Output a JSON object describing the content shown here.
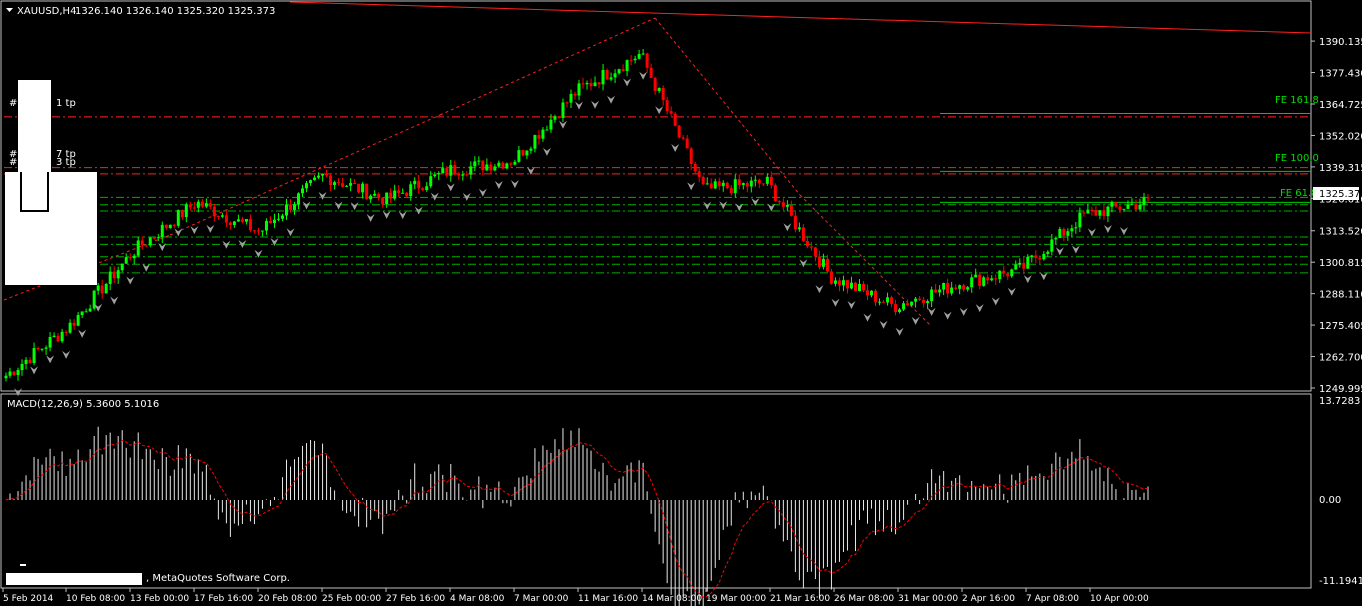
{
  "header": {
    "symbol_label": "XAUUSD,H4",
    "ohlc": "1326.140 1326.140 1325.320 1325.373"
  },
  "macd": {
    "label": "MACD(12,26,9) 5.3600 5.1016",
    "scale_labels": [
      "13.7283",
      "0.00",
      "-11.1941"
    ]
  },
  "copyright": ", MetaQuotes Software Corp.",
  "price_axis": {
    "ticks": [
      "1390.135",
      "1377.430",
      "1364.725",
      "1352.020",
      "1339.315",
      "1326.610",
      "1313.520",
      "1300.815",
      "1288.110",
      "1275.405",
      "1262.700",
      "1249.995"
    ],
    "current_price": "1325.373"
  },
  "time_axis": {
    "ticks": [
      "5 Feb 2014",
      "10 Feb 08:00",
      "13 Feb 00:00",
      "17 Feb 16:00",
      "20 Feb 08:00",
      "25 Feb 00:00",
      "27 Feb 16:00",
      "4 Mar 08:00",
      "7 Mar 00:00",
      "11 Mar 16:00",
      "14 Mar 08:00",
      "19 Mar 00:00",
      "21 Mar 16:00",
      "26 Mar 08:00",
      "31 Mar 00:00",
      "2 Apr 16:00",
      "7 Apr 08:00",
      "10 Apr 00:00"
    ]
  },
  "level_labels": {
    "fe_161": "FE 161.8",
    "fe_100": "FE 100.0",
    "fe_61": "FE 61.8",
    "tp1": "1 tp",
    "tp7": "7 tp",
    "tp3": "3 tp",
    "hash": "#"
  },
  "colors": {
    "background": "#000000",
    "bull": "#00ff00",
    "bear": "#ff0000",
    "fe_line": "#00cc00",
    "level_red": "#ff2020",
    "level_green": "#00b000",
    "trend_line": "#ff2020"
  },
  "chart_data": [
    {
      "type": "candlestick",
      "symbol": "XAUUSD",
      "timeframe": "H4",
      "ylim": [
        1249.995,
        1393
      ],
      "trend": [
        {
          "date": "5 Feb",
          "price": 1255
        },
        {
          "date": "10 Feb",
          "price": 1275
        },
        {
          "date": "13 Feb",
          "price": 1305
        },
        {
          "date": "17 Feb",
          "price": 1325
        },
        {
          "date": "20 Feb",
          "price": 1313
        },
        {
          "date": "25 Feb",
          "price": 1336
        },
        {
          "date": "27 Feb",
          "price": 1326
        },
        {
          "date": "4 Mar",
          "price": 1338
        },
        {
          "date": "7 Mar",
          "price": 1342
        },
        {
          "date": "11 Mar",
          "price": 1370
        },
        {
          "date": "14 Mar",
          "price": 1385
        },
        {
          "date": "19 Mar",
          "price": 1330
        },
        {
          "date": "21 Mar",
          "price": 1333
        },
        {
          "date": "26 Mar",
          "price": 1295
        },
        {
          "date": "31 Mar",
          "price": 1283
        },
        {
          "date": "2 Apr",
          "price": 1292
        },
        {
          "date": "7 Apr",
          "price": 1298
        },
        {
          "date": "10 Apr",
          "price": 1320
        },
        {
          "date": "11 Apr",
          "price": 1325.373
        }
      ],
      "levels": {
        "fe_161_8": 1360.5,
        "fe_100": 1337.5,
        "fe_61_8": 1325.0,
        "tp1": 1359.5,
        "tp7": 1339.0,
        "tp3": 1336.5,
        "green_dashed": [
          1327.0,
          1324.0,
          1321.5,
          1311.0,
          1308.0,
          1303.0,
          1300.0,
          1296.5
        ]
      }
    },
    {
      "type": "bar",
      "name": "MACD(12,26,9)",
      "main": 5.36,
      "signal": 5.1016,
      "ylim": [
        -11.1941,
        13.7283
      ]
    }
  ]
}
